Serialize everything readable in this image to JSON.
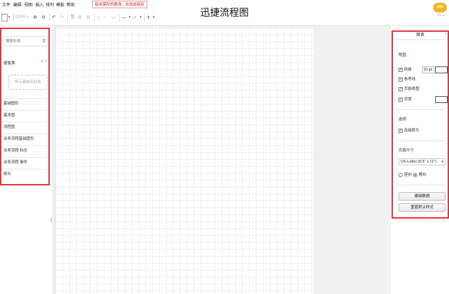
{
  "menu": [
    "文件",
    "编辑",
    "视图",
    "插入",
    "排列",
    "模板",
    "帮助"
  ],
  "save_notice": "有未保存的更改，点击此保存",
  "app_title": "迅捷流程图",
  "vip": {
    "badge": "VIP"
  },
  "toolbar": {
    "page_icon": "▯",
    "zoom": "100%",
    "zoom_in": "⊕",
    "zoom_out": "⊖",
    "undo": "↶",
    "redo": "↷",
    "delete": "🗑",
    "to_front": "⧉",
    "to_back": "⧉",
    "fill": "◇",
    "line_color": "∕",
    "shadow": "▭",
    "line_style": "—",
    "waypoint": "⌐",
    "insert": "+"
  },
  "sidebar": {
    "search_placeholder": "搜索形状",
    "scratchpad_label": "便笺簿",
    "drop_hint": "将元素拖到此处",
    "items": [
      {
        "label": "基础图形"
      },
      {
        "label": "基本图"
      },
      {
        "label": "流程图"
      },
      {
        "label": "业务流程基础图形"
      },
      {
        "label": "业务流程 标志"
      },
      {
        "label": "业务流程 事件"
      },
      {
        "label": "箭头"
      }
    ]
  },
  "format_panel": {
    "title": "图表",
    "section_view": "视图",
    "grid_label": "网格",
    "grid_size": "10 pt",
    "guides_label": "参考线",
    "page_view_label": "页面视图",
    "background_label": "背景",
    "section_options": "选项",
    "connection_arrows_label": "连接箭头",
    "section_paper": "页面尺寸",
    "paper_size": "US-Letter (8.5\" x 11\")",
    "portrait_label": "竖向",
    "landscape_label": "横向",
    "edit_data_button": "编辑数据",
    "reset_style_button": "重置默认样式",
    "checked": {
      "grid": true,
      "guides": true,
      "page_view": true,
      "background": true,
      "connection_arrows": true
    },
    "orientation": "landscape"
  },
  "colors": {
    "highlight_border": "#e5323b",
    "vip_gold": "#f3b51f",
    "notice_red": "#d02020"
  }
}
